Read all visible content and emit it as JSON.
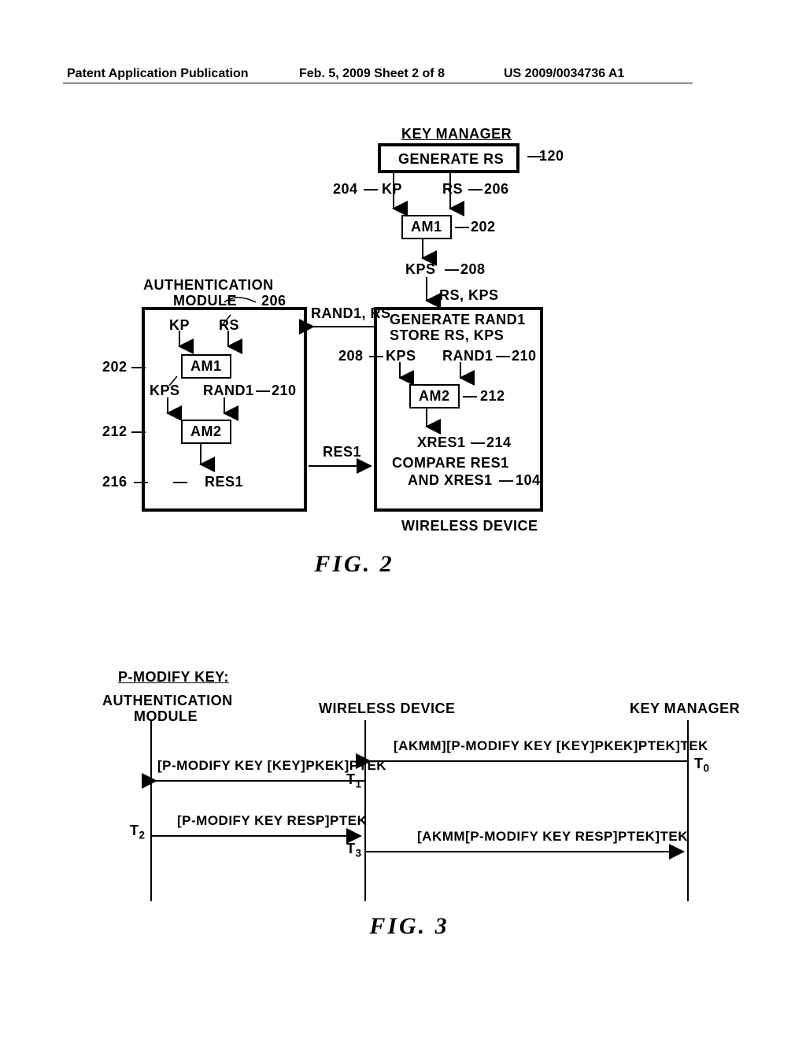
{
  "header": {
    "left": "Patent Application Publication",
    "center": "Feb. 5, 2009  Sheet 2 of 8",
    "right": "US 2009/0034736 A1"
  },
  "fig2": {
    "caption": "FIG. 2",
    "key_manager_title": "KEY MANAGER",
    "generate_rs": "GENERATE RS",
    "kp": "KP",
    "rs": "RS",
    "am1": "AM1",
    "kps": "KPS",
    "rs_kps": "RS, KPS",
    "rand1_rs": "RAND1, RS",
    "gen_rand1": "GENERATE RAND1",
    "store_rs_kps": "STORE RS, KPS",
    "rand1": "RAND1",
    "am2": "AM2",
    "xres1": "XRES1",
    "compare": "COMPARE RES1",
    "and_xres1": "AND XRES1",
    "wireless_device": "WIRELESS DEVICE",
    "auth_module": "AUTHENTICATION",
    "auth_module2": "MODULE",
    "res1": "RES1",
    "ref": {
      "r120": "120",
      "r204": "204",
      "r206": "206",
      "r202": "202",
      "r208": "208",
      "r210": "210",
      "r212": "212",
      "r214": "214",
      "r216": "216",
      "r104": "104"
    }
  },
  "fig3": {
    "caption": "FIG. 3",
    "title": "P-MODIFY KEY:",
    "auth_module": "AUTHENTICATION",
    "auth_module2": "MODULE",
    "wireless_device": "WIRELESS DEVICE",
    "key_manager": "KEY MANAGER",
    "msg_km_to_wd": "[AKMM][P-MODIFY KEY [KEY]PKEK]PTEK]TEK",
    "msg_wd_to_am": "[P-MODIFY KEY [KEY]PKEK]PTEK",
    "msg_am_to_wd": "[P-MODIFY KEY RESP]PTEK",
    "msg_wd_to_km": "[AKMM[P-MODIFY KEY RESP]PTEK]TEK",
    "t0": "T0",
    "t1": "T1",
    "t2": "T2",
    "t3": "T3"
  }
}
